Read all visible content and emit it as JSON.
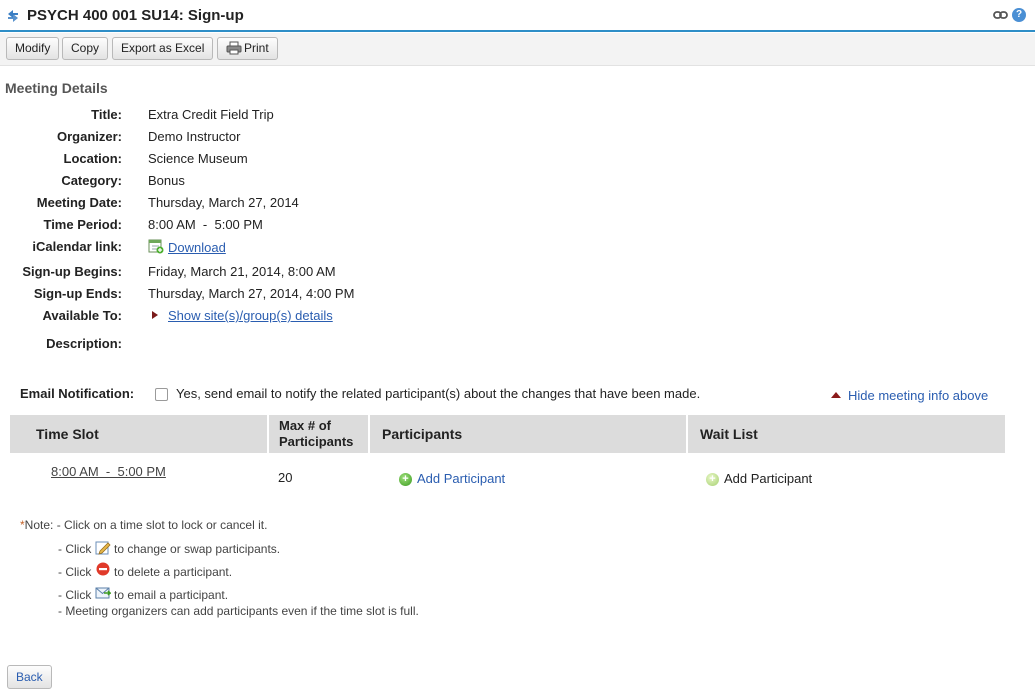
{
  "header": {
    "title": "PSYCH 400 001 SU14: Sign-up"
  },
  "toolbar": {
    "modify": "Modify",
    "copy": "Copy",
    "export": "Export as Excel",
    "print": "Print"
  },
  "meeting": {
    "section_title": "Meeting Details",
    "rows": [
      {
        "label": "Title:",
        "value": "Extra Credit Field Trip"
      },
      {
        "label": "Organizer:",
        "value": "Demo Instructor"
      },
      {
        "label": "Location:",
        "value": "Science Museum"
      },
      {
        "label": "Category:",
        "value": "Bonus"
      },
      {
        "label": "Meeting Date:",
        "value": "Thursday, March 27, 2014"
      },
      {
        "label": "Time Period:",
        "value": "8:00 AM  -  5:00 PM"
      },
      {
        "label": "iCalendar link:",
        "value": "Download"
      },
      {
        "label": "Sign-up Begins:",
        "value": "Friday, March 21, 2014, 8:00 AM"
      },
      {
        "label": "Sign-up Ends:",
        "value": "Thursday, March 27, 2014, 4:00 PM"
      },
      {
        "label": "Available To:",
        "value": "Show site(s)/group(s) details"
      },
      {
        "label": "Description:",
        "value": ""
      }
    ]
  },
  "email": {
    "label": "Email Notification:",
    "checkbox_text": "Yes, send email to notify the related participant(s) about the changes that have been made.",
    "checked": false
  },
  "hide_info": "Hide meeting info above",
  "table": {
    "headers": [
      "Time Slot",
      "Max # of Participants",
      "Participants",
      "Wait List"
    ],
    "rows": [
      {
        "time_slot": "8:00 AM  -  5:00 PM",
        "max": "20",
        "participants_action": "Add Participant",
        "waitlist_action": "Add Participant"
      }
    ]
  },
  "notes": {
    "star": "*",
    "prefix": "Note:",
    "line1": "- Click on a time slot to lock or cancel it.",
    "line2_a": "- Click",
    "line2_b": "to change or swap participants.",
    "line3_a": "- Click",
    "line3_b": "to delete a participant.",
    "line4_a": "- Click",
    "line4_b": "to email a participant.",
    "line5": "- Meeting organizers can add participants even if the time slot is full."
  },
  "footer": {
    "back": "Back"
  },
  "colors": {
    "accent_border": "#2e8ec7",
    "link": "#2a5db0",
    "table_header_bg": "#dcdcdc"
  }
}
